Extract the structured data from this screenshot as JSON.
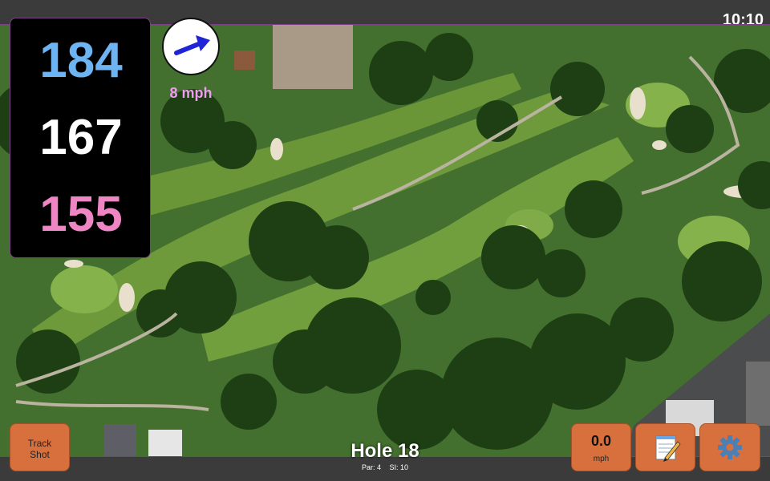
{
  "status_bar": {
    "time": "10:10"
  },
  "distances": {
    "back": "184",
    "middle": "167",
    "front": "155"
  },
  "wind": {
    "speed": "8 mph",
    "icon": "wind-arrow-icon"
  },
  "buttons": {
    "track_shot_line1": "Track",
    "track_shot_line2": "Shot",
    "speed_value": "0.0",
    "speed_unit": "mph",
    "notes_icon": "notepad-icon",
    "settings_icon": "gear-icon"
  },
  "hole": {
    "title": "Hole 18",
    "par": "Par: 4",
    "si": "SI: 10"
  },
  "colors": {
    "back": "#6eb4f2",
    "middle": "#ffffff",
    "front": "#ee86c4",
    "button": "#d8703e",
    "wind_text": "#ee9bf0"
  }
}
